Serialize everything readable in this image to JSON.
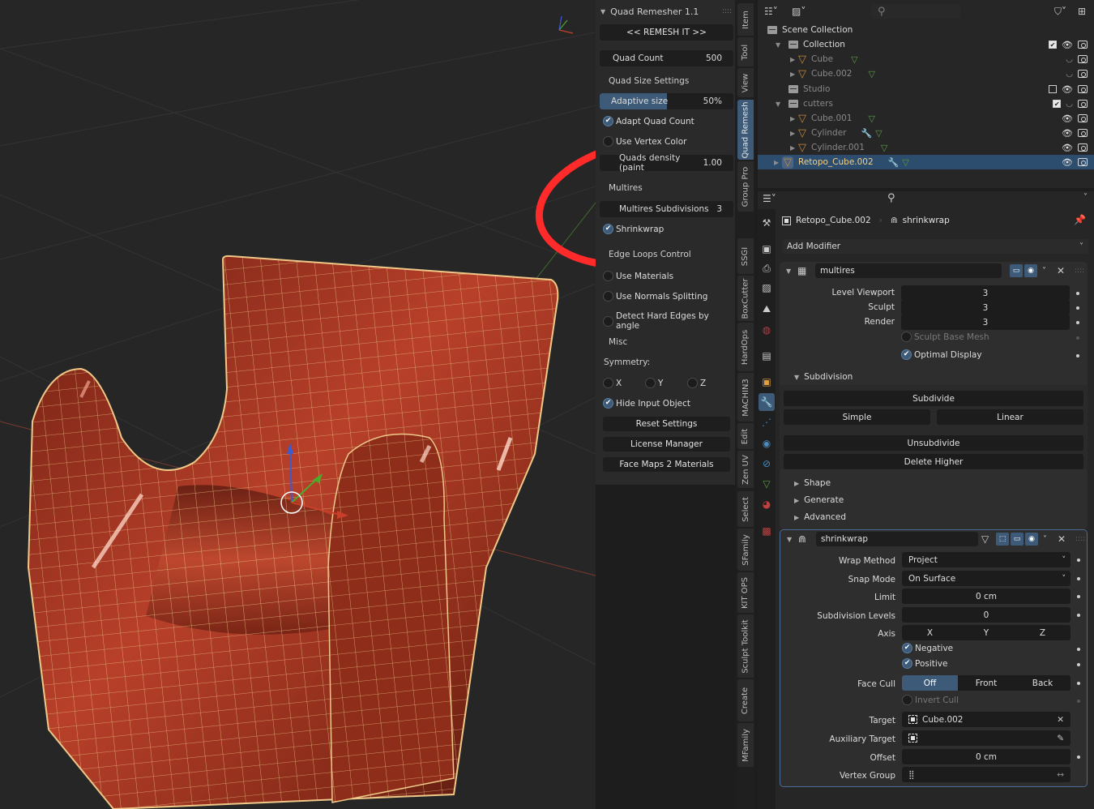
{
  "viewport": {
    "gizmo_axes": [
      "X",
      "Y",
      "Z"
    ],
    "object_color": "#c0452a",
    "wire_color": "#f0c888",
    "annotation_color": "#ff2a2a"
  },
  "n_panel": {
    "title": "Quad Remesher 1.1",
    "remesh_button": "<<  REMESH IT  >>",
    "quad_count": {
      "label": "Quad Count",
      "value": "500"
    },
    "quad_size_settings": "Quad Size Settings",
    "adaptive_size": {
      "label": "Adaptive size",
      "value": "50%",
      "fraction": 0.5
    },
    "adapt_quad_count": {
      "label": "Adapt Quad Count",
      "checked": true
    },
    "use_vertex_color": {
      "label": "Use Vertex Color",
      "checked": false
    },
    "quads_density": {
      "label": "Quads density (paint",
      "value": "1.00"
    },
    "multires": "Multires",
    "multires_subdivisions": {
      "label": "Multires Subdivisions",
      "value": "3"
    },
    "shrinkwrap": {
      "label": "Shrinkwrap",
      "checked": true
    },
    "edge_loops_control": "Edge Loops Control",
    "use_materials": {
      "label": "Use Materials",
      "checked": false
    },
    "use_normals_splitting": {
      "label": "Use Normals Splitting",
      "checked": false
    },
    "detect_hard_edges": {
      "label": "Detect Hard Edges by angle",
      "checked": false
    },
    "misc": "Misc",
    "symmetry": "Symmetry:",
    "sym_x": "X",
    "sym_y": "Y",
    "sym_z": "Z",
    "hide_input_object": {
      "label": "Hide Input Object",
      "checked": true
    },
    "reset_settings": "Reset Settings",
    "license_manager": "License Manager",
    "face_maps_2_materials": "Face Maps 2 Materials"
  },
  "side_tabs": [
    "Item",
    "Tool",
    "View",
    "Quad Remesh",
    "Group Pro",
    "SSGI",
    "BoxCutter",
    "HardOps",
    "MACHIN3",
    "Edit",
    "Zen UV",
    "Select",
    "SFamily",
    "KIT OPS",
    "Sculpt Toolkit",
    "Create",
    "MFamily"
  ],
  "active_side_tab": "Quad Remesh",
  "outliner": {
    "rows": [
      {
        "name": "Scene Collection",
        "type": "scene"
      },
      {
        "name": "Collection",
        "type": "collection"
      },
      {
        "name": "Cube",
        "type": "object"
      },
      {
        "name": "Cube.002",
        "type": "object"
      },
      {
        "name": "Studio",
        "type": "collection"
      },
      {
        "name": "cutters",
        "type": "collection"
      },
      {
        "name": "Cube.001",
        "type": "object"
      },
      {
        "name": "Cylinder",
        "type": "object"
      },
      {
        "name": "Cylinder.001",
        "type": "object"
      },
      {
        "name": "Retopo_Cube.002",
        "type": "object",
        "selected": true
      }
    ]
  },
  "properties": {
    "breadcrumb_object": "Retopo_Cube.002",
    "breadcrumb_modifier": "shrinkwrap",
    "add_modifier": "Add Modifier",
    "multires": {
      "name": "multires",
      "level_viewport": {
        "label": "Level Viewport",
        "value": "3"
      },
      "sculpt": {
        "label": "Sculpt",
        "value": "3"
      },
      "render": {
        "label": "Render",
        "value": "3"
      },
      "sculpt_base_mesh": {
        "label": "Sculpt Base Mesh",
        "checked": false
      },
      "optimal_display": {
        "label": "Optimal Display",
        "checked": true
      },
      "subdivision": "Subdivision",
      "subdivide": "Subdivide",
      "simple": "Simple",
      "linear": "Linear",
      "unsubdivide": "Unsubdivide",
      "delete_higher": "Delete Higher",
      "shape": "Shape",
      "generate": "Generate",
      "advanced": "Advanced"
    },
    "shrinkwrap": {
      "name": "shrinkwrap",
      "wrap_method": {
        "label": "Wrap Method",
        "value": "Project"
      },
      "snap_mode": {
        "label": "Snap Mode",
        "value": "On Surface"
      },
      "limit": {
        "label": "Limit",
        "value": "0 cm"
      },
      "subdivision_levels": {
        "label": "Subdivision Levels",
        "value": "0"
      },
      "axis": {
        "label": "Axis",
        "x": "X",
        "y": "Y",
        "z": "Z"
      },
      "negative": {
        "label": "Negative",
        "checked": true
      },
      "positive": {
        "label": "Positive",
        "checked": true
      },
      "face_cull": {
        "label": "Face Cull",
        "off": "Off",
        "front": "Front",
        "back": "Back",
        "selected": "Off"
      },
      "invert_cull": {
        "label": "Invert Cull",
        "checked": false
      },
      "target": {
        "label": "Target",
        "value": "Cube.002"
      },
      "auxiliary_target": {
        "label": "Auxiliary Target",
        "value": ""
      },
      "offset": {
        "label": "Offset",
        "value": "0 cm"
      },
      "vertex_group": {
        "label": "Vertex Group",
        "value": ""
      }
    }
  }
}
